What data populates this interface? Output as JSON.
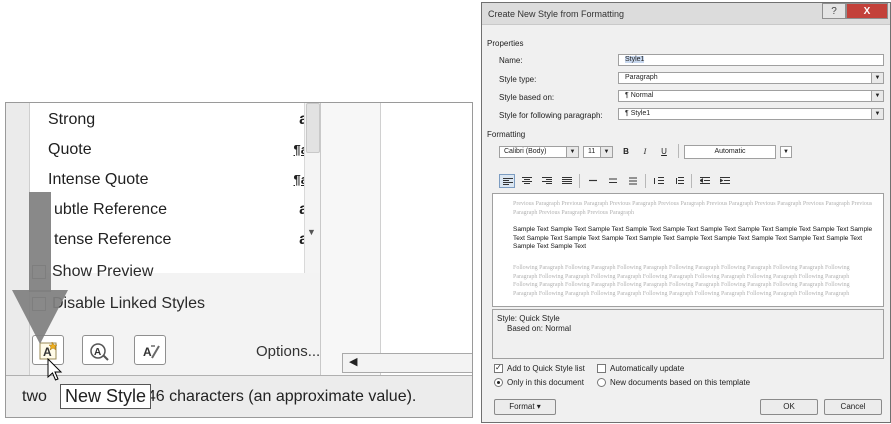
{
  "styles_pane": {
    "items": [
      {
        "label": "Strong",
        "symbol": "a",
        "kind": "char"
      },
      {
        "label": "Quote",
        "symbol": "¶a",
        "kind": "linked"
      },
      {
        "label": "Intense Quote",
        "symbol": "¶a",
        "kind": "linked"
      },
      {
        "label": "ubtle Reference",
        "symbol": "a",
        "kind": "char"
      },
      {
        "label": "tense Reference",
        "symbol": "a",
        "kind": "char"
      }
    ],
    "show_preview_label": "Show Preview",
    "disable_linked_label": "Disable Linked Styles",
    "options_label": "Options...",
    "tooltip": "New Style",
    "status_prefix": "two",
    "status_suffix": "46 characters (an approximate value).",
    "arrow_color": "#7f7f7f"
  },
  "dialog": {
    "title": "Create New Style from Formatting",
    "help_btn": "?",
    "close_btn": "X",
    "properties_heading": "Properties",
    "name_label": "Name:",
    "name_value": "Style1",
    "style_type_label": "Style type:",
    "style_type_value": "Paragraph",
    "based_on_label": "Style based on:",
    "based_on_value": "¶ Normal",
    "following_label": "Style for following paragraph:",
    "following_value": "¶ Style1",
    "formatting_heading": "Formatting",
    "font": "Calibri (Body)",
    "size": "11",
    "bold": "B",
    "italic": "I",
    "underline": "U",
    "color": "Automatic",
    "preview_previous": "Previous Paragraph Previous Paragraph Previous Paragraph Previous Paragraph Previous Paragraph Previous Paragraph Previous Paragraph Previous Paragraph Previous Paragraph Previous Paragraph",
    "preview_sample": "Sample Text Sample Text Sample Text Sample Text Sample Text Sample Text Sample Text Sample Text Sample Text Sample Text Sample Text Sample Text Sample Text Sample Text Sample Text Sample Text Sample Text Sample Text Sample Text Sample Text Sample Text",
    "preview_following": "Following Paragraph Following Paragraph Following Paragraph Following Paragraph Following Paragraph Following Paragraph Following Paragraph Following Paragraph Following Paragraph Following Paragraph Following Paragraph Following Paragraph Following Paragraph Following Paragraph Following Paragraph Following Paragraph Following Paragraph Following Paragraph Following Paragraph Following Paragraph Following Paragraph Following Paragraph Following Paragraph Following Paragraph Following Paragraph Following Paragraph",
    "description_line1": "Style: Quick Style",
    "description_line2": "Based on: Normal",
    "add_quick_label": "Add to Quick Style list",
    "add_quick_checked": true,
    "auto_update_label": "Automatically update",
    "auto_update_checked": false,
    "only_doc_label": "Only in this document",
    "new_docs_label": "New documents based on this template",
    "format_btn": "Format ▾",
    "ok_btn": "OK",
    "cancel_btn": "Cancel",
    "close_color": "#c3413a"
  }
}
